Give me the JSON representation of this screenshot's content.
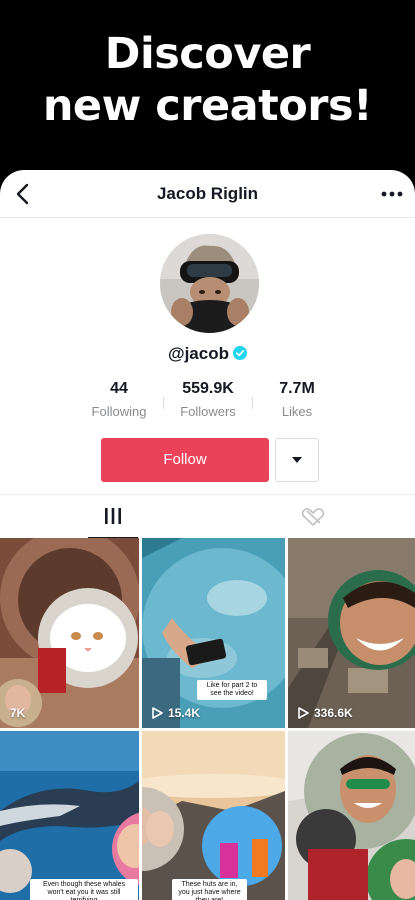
{
  "promo": {
    "line1": "Discover",
    "line2": "new creators!"
  },
  "header": {
    "title": "Jacob Riglin"
  },
  "profile": {
    "handle": "@jacob"
  },
  "stats": [
    {
      "value": "44",
      "label": "Following"
    },
    {
      "value": "559.9K",
      "label": "Followers"
    },
    {
      "value": "7.7M",
      "label": "Likes"
    }
  ],
  "actions": {
    "follow_label": "Follow"
  },
  "videos": [
    {
      "views": "7K"
    },
    {
      "views": "15.4K",
      "caption": "Like for part 2 to see the video!"
    },
    {
      "views": "336.6K"
    },
    {
      "caption": "Even though these whales won't eat you it was still terrifying"
    },
    {
      "caption": "These huts are in, you just have where they are!"
    },
    {}
  ],
  "colors": {
    "accent": "#ea4359",
    "verified": "#20d5ec",
    "text": "#161823",
    "muted": "#8a8b91"
  }
}
